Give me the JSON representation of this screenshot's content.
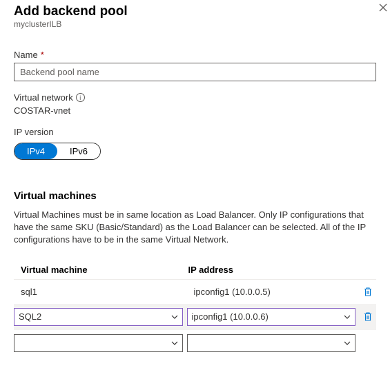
{
  "header": {
    "title": "Add backend pool",
    "subtitle": "myclusterILB"
  },
  "fields": {
    "name_label": "Name",
    "name_placeholder": "Backend pool name",
    "vnet_label": "Virtual network",
    "vnet_value": "COSTAR-vnet",
    "ip_version_label": "IP version",
    "ipv4_label": "IPv4",
    "ipv6_label": "IPv6"
  },
  "vm_section": {
    "heading": "Virtual machines",
    "description": "Virtual Machines must be in same location as Load Balancer. Only IP configurations that have the same SKU (Basic/Standard) as the Load Balancer can be selected. All of the IP configurations have to be in the same Virtual Network.",
    "col_vm": "Virtual machine",
    "col_ip": "IP address",
    "rows": [
      {
        "vm": "sql1",
        "ip": "ipconfig1 (10.0.0.5)"
      },
      {
        "vm": "SQL2",
        "ip": "ipconfig1 (10.0.0.6)"
      },
      {
        "vm": "",
        "ip": ""
      }
    ]
  }
}
